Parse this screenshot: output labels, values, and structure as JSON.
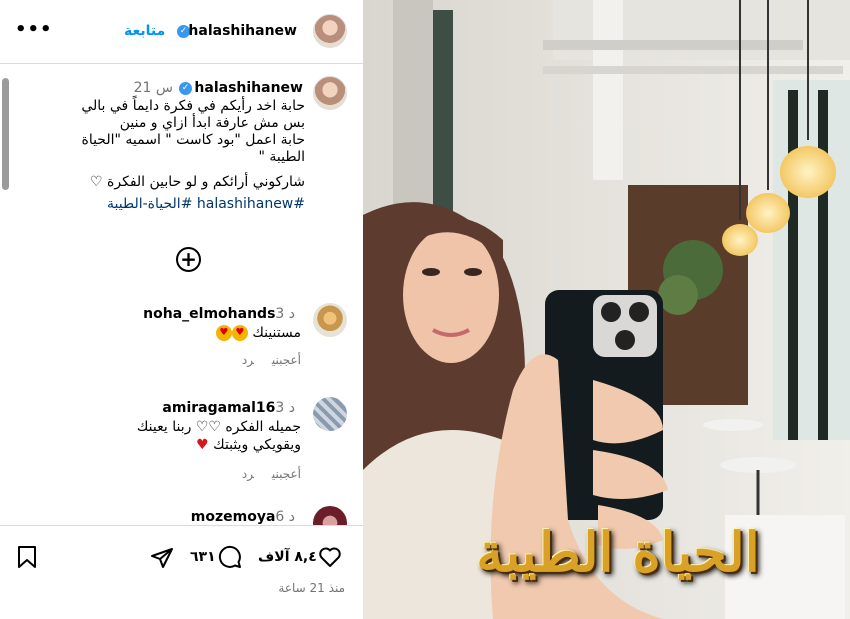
{
  "header": {
    "username": "halashihanew",
    "follow_label": "متابعة",
    "more_label": "•••"
  },
  "caption": {
    "username": "halashihanew",
    "time": "21 س",
    "lines": [
      "حابة اخد رأيكم في فكرة دايماً في بالي",
      "بس مش عارفة ابدأ ازاي و منين",
      "حابة اعمل \"بود كاست \" اسميه \"الحياة",
      "الطيبة \""
    ],
    "line_last": "شاركوني أرائكم و لو حابين الفكرة",
    "hashtags": "#halashihanew #الحياة-الطيبة"
  },
  "comments": [
    {
      "username": "noha_elmohands",
      "time": "3 د",
      "text": "مستنينك",
      "like_label": "أعجبني",
      "reply_label": "رد"
    },
    {
      "username": "amiragamal16",
      "time": "3 د",
      "text": "جميله الفكره",
      "text2": "ربنا يعينك",
      "text3": "ويقويكي ويثبتك",
      "like_label": "أعجبني",
      "reply_label": "رد"
    },
    {
      "username": "mozemoya",
      "time": "6 د"
    }
  ],
  "footer": {
    "likes": "٨,٤ آلاف",
    "comments": "٦٣١",
    "time_ago": "منذ 21 ساعة"
  },
  "photo": {
    "overlay_text": "الحياة الطيبة"
  },
  "colors": {
    "link": "#0095f6",
    "hashtag": "#00376b",
    "verified": "#3897f0",
    "muted": "#737373",
    "overlay_gold": "#d9a227"
  }
}
